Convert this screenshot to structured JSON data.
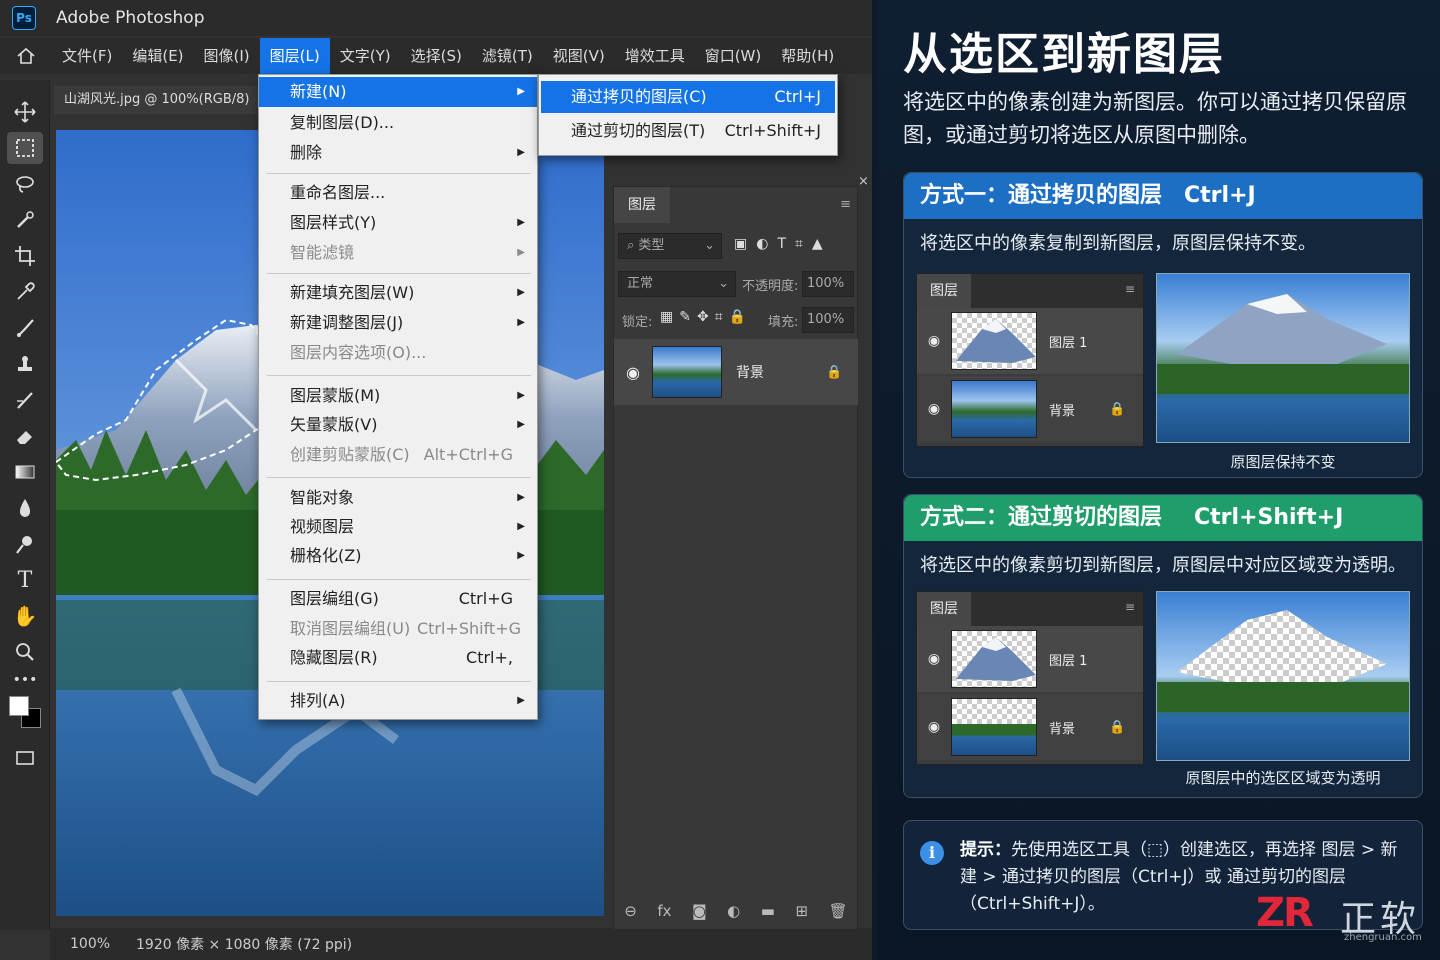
{
  "app": {
    "title": "Adobe Photoshop",
    "logo": "Ps"
  },
  "menubar": [
    "文件(F)",
    "编辑(E)",
    "图像(I)",
    "图层(L)",
    "文字(Y)",
    "选择(S)",
    "滤镜(T)",
    "视图(V)",
    "增效工具",
    "窗口(W)",
    "帮助(H)"
  ],
  "document": {
    "tab": "山湖风光.jpg @ 100%(RGB/8)",
    "close": "×"
  },
  "statusbar": {
    "zoom": "100%",
    "info": "1920 像素 × 1080 像素 (72 ppi)"
  },
  "layer_menu": {
    "new": "新建(N)",
    "duplicate": "复制图层(D)...",
    "delete": "删除",
    "rename": "重命名图层...",
    "style": "图层样式(Y)",
    "smart_filter": "智能滤镜",
    "fill_layer": "新建填充图层(W)",
    "adjust_layer": "新建调整图层(J)",
    "content_options": "图层内容选项(O)...",
    "layer_mask": "图层蒙版(M)",
    "vector_mask": "矢量蒙版(V)",
    "clip_mask": "创建剪贴蒙版(C)",
    "clip_mask_sc": "Alt+Ctrl+G",
    "smart_object": "智能对象",
    "video_layer": "视频图层",
    "rasterize": "栅格化(Z)",
    "group": "图层编组(G)",
    "group_sc": "Ctrl+G",
    "ungroup": "取消图层编组(U)",
    "ungroup_sc": "Ctrl+Shift+G",
    "hide": "隐藏图层(R)",
    "hide_sc": "Ctrl+,",
    "arrange": "排列(A)"
  },
  "submenu": {
    "copy": "通过拷贝的图层(C)",
    "copy_sc": "Ctrl+J",
    "cut": "通过剪切的图层(T)",
    "cut_sc": "Ctrl+Shift+J"
  },
  "layers_panel": {
    "tab": "图层",
    "filter": "类型",
    "blend": "正常",
    "opacity_label": "不透明度:",
    "opacity": "100%",
    "lock_label": "锁定:",
    "fill_label": "填充:",
    "fill": "100%",
    "layer": "背景",
    "fx": "fx"
  },
  "tutorial": {
    "title": "从选区到新图层",
    "intro": "将选区中的像素创建为新图层。你可以通过拷贝保留原图，或通过剪切将选区从原图中删除。",
    "method1": {
      "head": "方式一：通过拷贝的图层",
      "hotkey": "Ctrl+J",
      "desc": "将选区中的像素复制到新图层，原图层保持不变。",
      "caption": "原图层保持不变"
    },
    "method2": {
      "head": "方式二：通过剪切的图层",
      "hotkey": "Ctrl+Shift+J",
      "desc": "将选区中的像素剪切到新图层，原图层中对应区域变为透明。",
      "caption": "原图层中的选区区域变为透明"
    },
    "mini": {
      "tab": "图层",
      "layer1": "图层 1",
      "bg": "背景"
    },
    "tip_label": "提示：",
    "tip": "先使用选区工具（⬚）创建选区，再选择 图层 > 新建 > 通过拷贝的图层（Ctrl+J）或 通过剪切的图层（Ctrl+Shift+J）。",
    "colors": {
      "blue_head": "#1d6fc4",
      "green_head": "#1f9d6b"
    }
  },
  "watermark": {
    "logo": "ZR",
    "name": "正软",
    "url": "zhengruan.com"
  }
}
